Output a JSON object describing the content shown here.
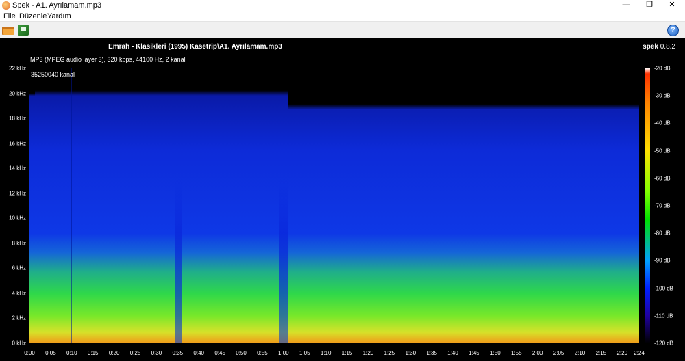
{
  "window": {
    "title": "Spek - A1. Ayrılamam.mp3",
    "controls": {
      "minimize": "—",
      "maximize": "❐",
      "close": "✕"
    }
  },
  "menu": {
    "items": [
      "File",
      "Düzenle",
      "Yardım"
    ]
  },
  "toolbar": {
    "open_icon": "folder-open-icon",
    "save_icon": "save-icon",
    "help_icon": "help-icon",
    "help_glyph": "?"
  },
  "spectrogram": {
    "file_title": "Emrah - Klasikleri (1995) Kasetrip\\A1. Ayrılamam.mp3",
    "brand_name": "spek",
    "brand_version": "0.8.2",
    "info": "MP3 (MPEG audio layer 3), 320 kbps, 44100 Hz, 2 kanal",
    "channel_label": "35250040 kanal",
    "freq_ticks": [
      "22 kHz",
      "20 kHz",
      "18 kHz",
      "16 kHz",
      "14 kHz",
      "12 kHz",
      "10 kHz",
      "8 kHz",
      "6 kHz",
      "4 kHz",
      "2 kHz",
      "0 kHz"
    ],
    "time_ticks": [
      "0:00",
      "0:05",
      "0:10",
      "0:15",
      "0:20",
      "0:25",
      "0:30",
      "0:35",
      "0:40",
      "0:45",
      "0:50",
      "0:55",
      "1:00",
      "1:05",
      "1:10",
      "1:15",
      "1:20",
      "1:25",
      "1:30",
      "1:35",
      "1:40",
      "1:45",
      "1:50",
      "1:55",
      "2:00",
      "2:05",
      "2:10",
      "2:15",
      "2:20",
      "2:24"
    ],
    "db_ticks": [
      "-20 dB",
      "-30 dB",
      "-40 dB",
      "-50 dB",
      "-60 dB",
      "-70 dB",
      "-80 dB",
      "-90 dB",
      "-100 dB",
      "-110 dB",
      "-120 dB"
    ]
  }
}
